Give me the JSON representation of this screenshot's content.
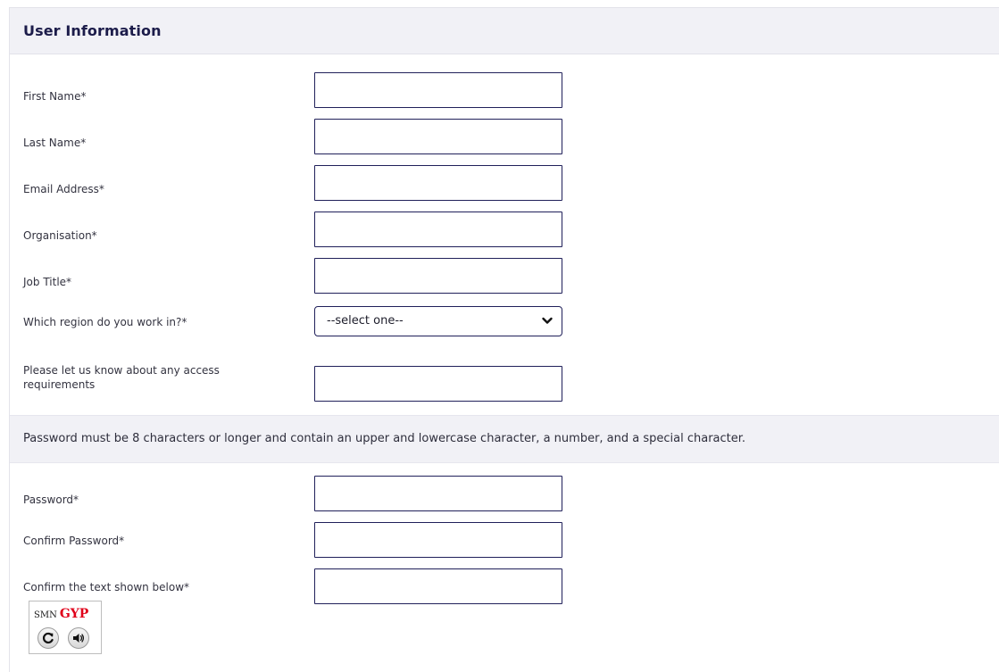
{
  "section": {
    "title": "User Information"
  },
  "fields": {
    "first_name": {
      "label": "First Name*",
      "value": ""
    },
    "last_name": {
      "label": "Last Name*",
      "value": ""
    },
    "email": {
      "label": "Email Address*",
      "value": ""
    },
    "organisation": {
      "label": "Organisation*",
      "value": ""
    },
    "job_title": {
      "label": "Job Title*",
      "value": ""
    },
    "region": {
      "label": "Which region do you work in?*",
      "selected": "--select one--"
    },
    "access": {
      "label_line1": "Please let us know about any access",
      "label_line2": "requirements",
      "value": ""
    },
    "password": {
      "label": "Password*",
      "value": ""
    },
    "confirm_password": {
      "label": "Confirm Password*",
      "value": ""
    },
    "captcha_input": {
      "label": "Confirm the text shown below*",
      "value": ""
    }
  },
  "password_notice": "Password must be 8 characters or longer and contain an upper and lowercase character, a number, and a special character.",
  "captcha": {
    "text_part1": "SMN",
    "text_part2": "GYP",
    "refresh_icon": "refresh-icon",
    "audio_icon": "speaker-icon"
  },
  "colors": {
    "field_border": "#20205a",
    "header_background": "#f1f1f6",
    "captcha_red": "#e0001a"
  }
}
